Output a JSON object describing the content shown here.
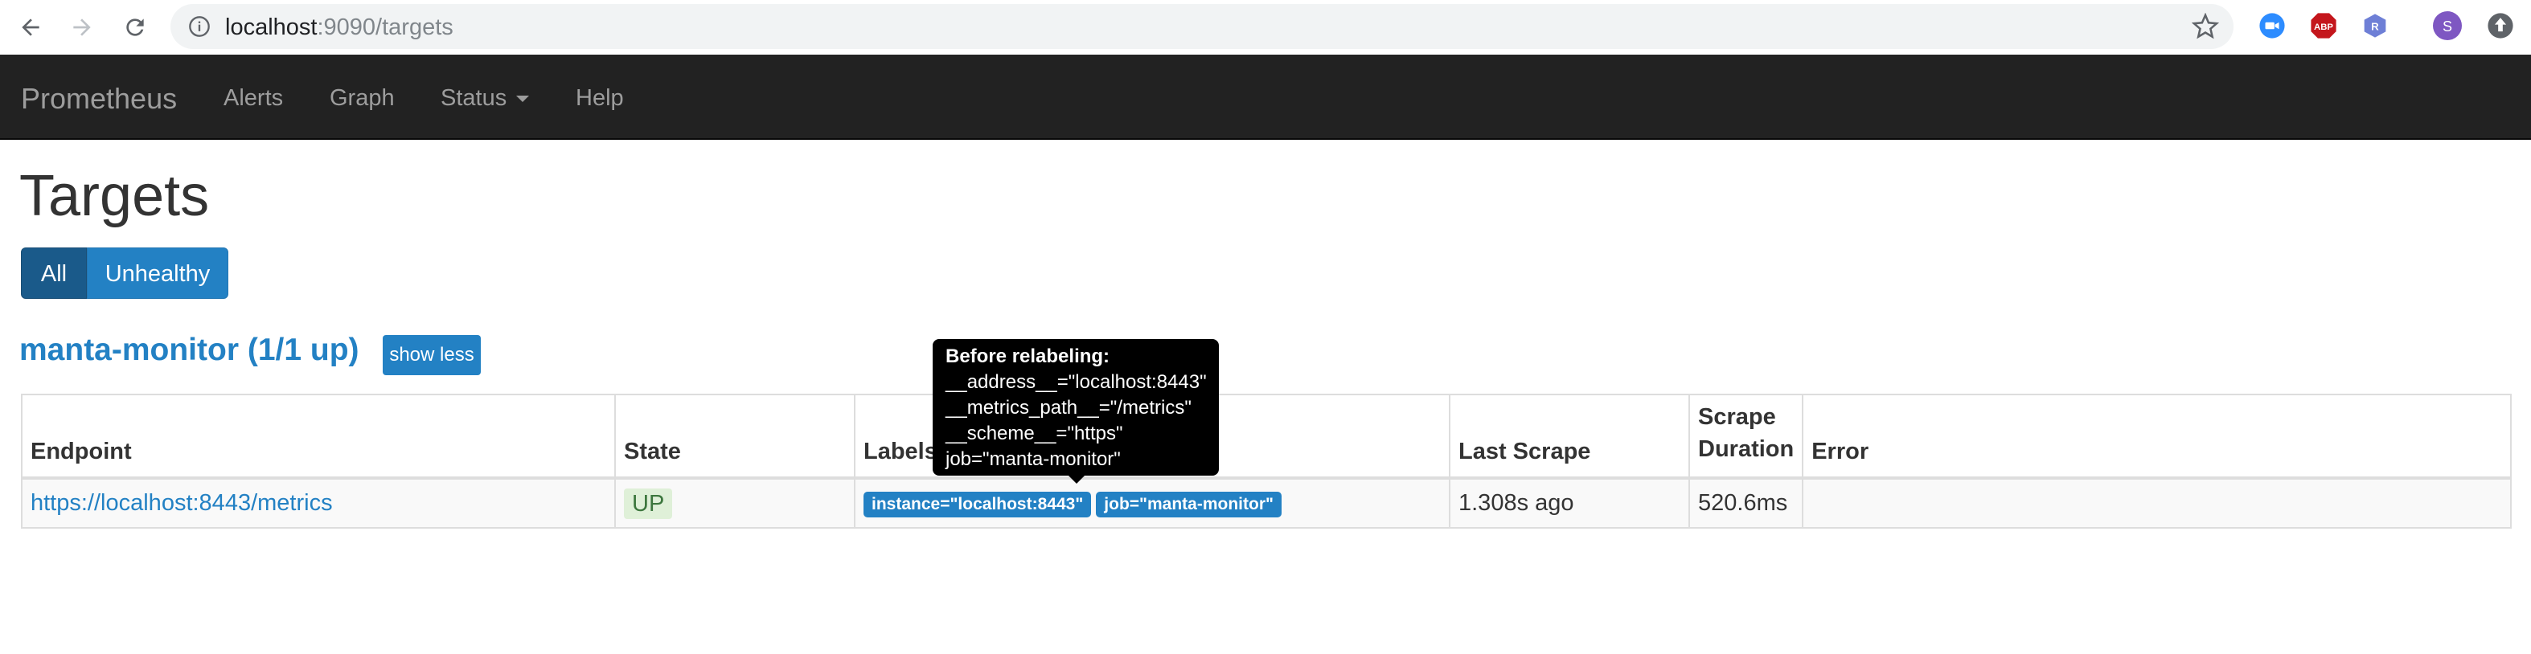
{
  "browser": {
    "url_host": "localhost",
    "url_rest": ":9090/targets",
    "back_icon": "arrow-left-icon",
    "forward_icon": "arrow-right-icon",
    "reload_icon": "reload-icon",
    "extensions": [
      {
        "name": "zoom-extension-icon",
        "color": "#2d8cff"
      },
      {
        "name": "adblock-extension-icon",
        "color": "#c4161c",
        "label": "ABP"
      },
      {
        "name": "r-extension-icon",
        "color": "#6e7fd6",
        "label": "R"
      },
      {
        "name": "profile-avatar",
        "color": "#7e57c2",
        "label": "S"
      },
      {
        "name": "update-icon",
        "color": "#5f6368"
      }
    ]
  },
  "navbar": {
    "brand": "Prometheus",
    "links": [
      "Alerts",
      "Graph",
      "Status",
      "Help"
    ]
  },
  "page": {
    "title": "Targets",
    "filters": [
      "All",
      "Unhealthy"
    ],
    "job_title": "manta-monitor (1/1 up)",
    "toggle_label": "show less"
  },
  "table": {
    "headers": {
      "endpoint": "Endpoint",
      "state": "State",
      "labels": "Labels",
      "last_scrape": "Last Scrape",
      "duration_line1": "Scrape",
      "duration_line2": "Duration",
      "error": "Error"
    },
    "rows": [
      {
        "endpoint": "https://localhost:8443/metrics",
        "state": "UP",
        "labels": [
          "instance=\"localhost:8443\"",
          "job=\"manta-monitor\""
        ],
        "last_scrape": "1.308s ago",
        "duration": "520.6ms",
        "error": ""
      }
    ]
  },
  "tooltip": {
    "title": "Before relabeling:",
    "lines": [
      "__address__=\"localhost:8443\"",
      "__metrics_path__=\"/metrics\"",
      "__scheme__=\"https\"",
      "job=\"manta-monitor\""
    ]
  },
  "colors": {
    "navbar_bg": "#222222",
    "primary": "#2381c4",
    "success_bg": "#dff0d8"
  }
}
